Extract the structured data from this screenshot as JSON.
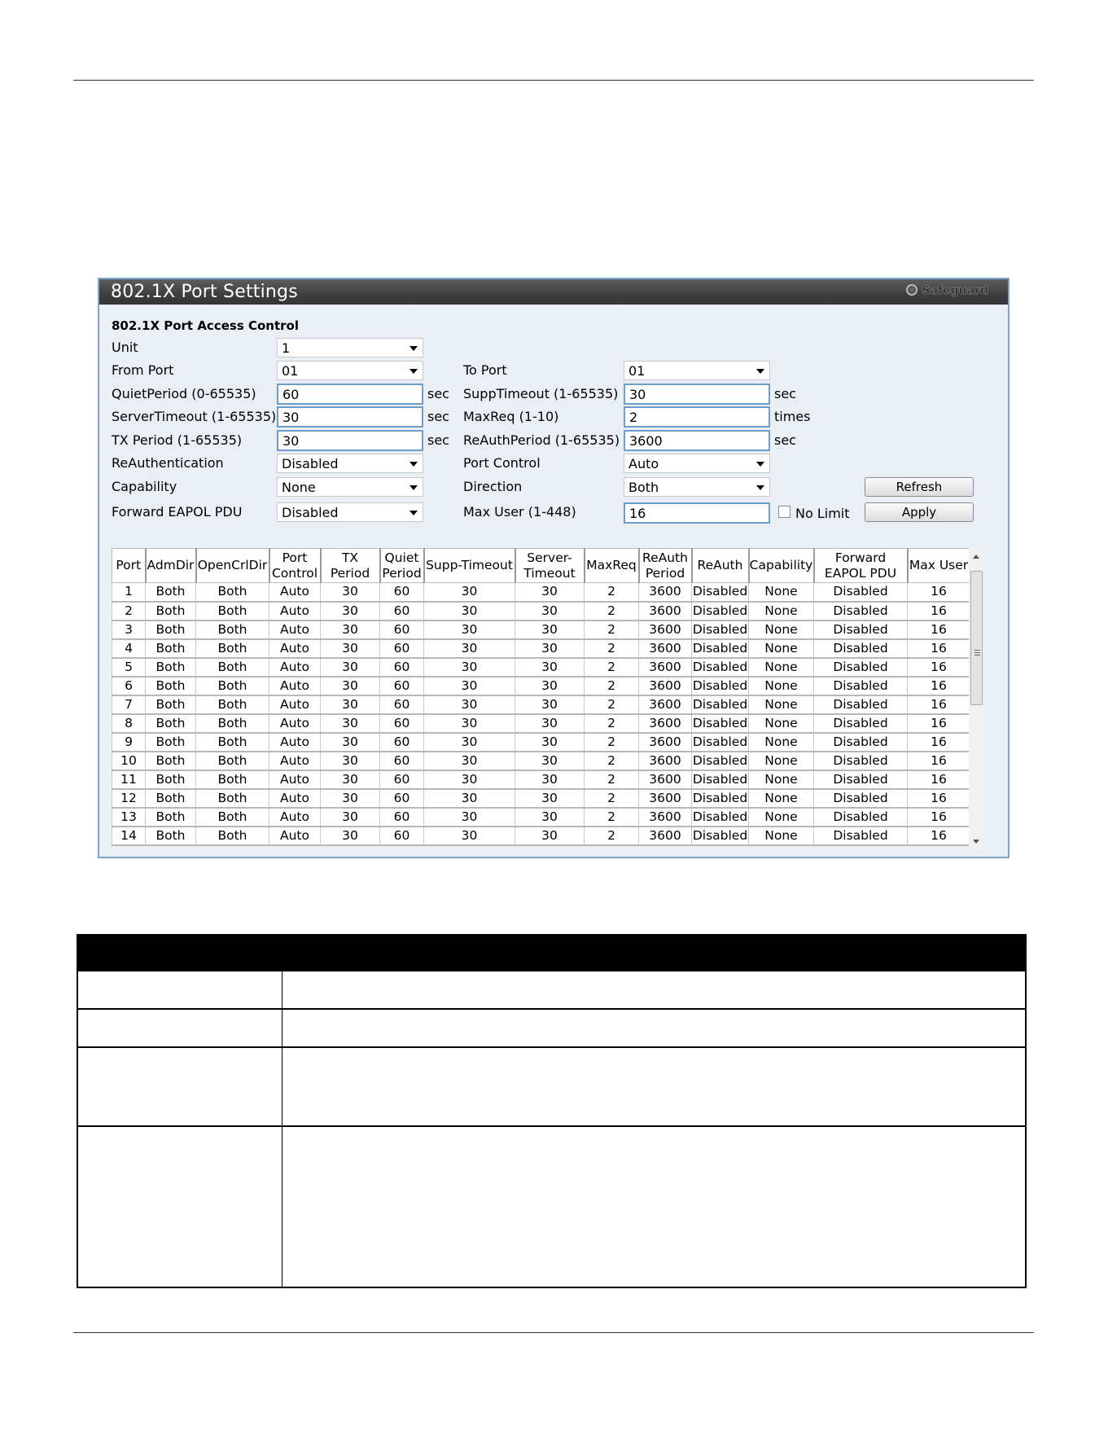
{
  "panel": {
    "title": "802.1X Port Settings",
    "safeguard": "Safeguard",
    "section": "802.1X Port Access Control"
  },
  "form": {
    "unit": {
      "label": "Unit",
      "value": "1"
    },
    "from_port": {
      "label": "From Port",
      "value": "01"
    },
    "to_port": {
      "label": "To Port",
      "value": "01"
    },
    "quiet_period": {
      "label": "QuietPeriod (0-65535)",
      "value": "60",
      "unit": "sec"
    },
    "supp_timeout": {
      "label": "SuppTimeout (1-65535)",
      "value": "30",
      "unit": "sec"
    },
    "server_timeout": {
      "label": "ServerTimeout (1-65535)",
      "value": "30",
      "unit": "sec"
    },
    "max_req": {
      "label": "MaxReq (1-10)",
      "value": "2",
      "unit": "times"
    },
    "tx_period": {
      "label": "TX Period (1-65535)",
      "value": "30",
      "unit": "sec"
    },
    "reauth_period": {
      "label": "ReAuthPeriod (1-65535)",
      "value": "3600",
      "unit": "sec"
    },
    "reauthentication": {
      "label": "ReAuthentication",
      "value": "Disabled"
    },
    "port_control": {
      "label": "Port Control",
      "value": "Auto"
    },
    "capability": {
      "label": "Capability",
      "value": "None"
    },
    "direction": {
      "label": "Direction",
      "value": "Both"
    },
    "forward_eapol": {
      "label": "Forward EAPOL PDU",
      "value": "Disabled"
    },
    "max_user": {
      "label": "Max User (1-448)",
      "value": "16"
    },
    "no_limit": {
      "label": "No Limit"
    }
  },
  "buttons": {
    "refresh": "Refresh",
    "apply": "Apply"
  },
  "table": {
    "headers": [
      "Port",
      "AdmDir",
      "OpenCrlDir",
      "Port\nControl",
      "TX\nPeriod",
      "Quiet\nPeriod",
      "Supp-Timeout",
      "Server-\nTimeout",
      "MaxReq",
      "ReAuth\nPeriod",
      "ReAuth",
      "Capability",
      "Forward\nEAPOL PDU",
      "Max User"
    ],
    "rows": [
      [
        "1",
        "Both",
        "Both",
        "Auto",
        "30",
        "60",
        "30",
        "30",
        "2",
        "3600",
        "Disabled",
        "None",
        "Disabled",
        "16"
      ],
      [
        "2",
        "Both",
        "Both",
        "Auto",
        "30",
        "60",
        "30",
        "30",
        "2",
        "3600",
        "Disabled",
        "None",
        "Disabled",
        "16"
      ],
      [
        "3",
        "Both",
        "Both",
        "Auto",
        "30",
        "60",
        "30",
        "30",
        "2",
        "3600",
        "Disabled",
        "None",
        "Disabled",
        "16"
      ],
      [
        "4",
        "Both",
        "Both",
        "Auto",
        "30",
        "60",
        "30",
        "30",
        "2",
        "3600",
        "Disabled",
        "None",
        "Disabled",
        "16"
      ],
      [
        "5",
        "Both",
        "Both",
        "Auto",
        "30",
        "60",
        "30",
        "30",
        "2",
        "3600",
        "Disabled",
        "None",
        "Disabled",
        "16"
      ],
      [
        "6",
        "Both",
        "Both",
        "Auto",
        "30",
        "60",
        "30",
        "30",
        "2",
        "3600",
        "Disabled",
        "None",
        "Disabled",
        "16"
      ],
      [
        "7",
        "Both",
        "Both",
        "Auto",
        "30",
        "60",
        "30",
        "30",
        "2",
        "3600",
        "Disabled",
        "None",
        "Disabled",
        "16"
      ],
      [
        "8",
        "Both",
        "Both",
        "Auto",
        "30",
        "60",
        "30",
        "30",
        "2",
        "3600",
        "Disabled",
        "None",
        "Disabled",
        "16"
      ],
      [
        "9",
        "Both",
        "Both",
        "Auto",
        "30",
        "60",
        "30",
        "30",
        "2",
        "3600",
        "Disabled",
        "None",
        "Disabled",
        "16"
      ],
      [
        "10",
        "Both",
        "Both",
        "Auto",
        "30",
        "60",
        "30",
        "30",
        "2",
        "3600",
        "Disabled",
        "None",
        "Disabled",
        "16"
      ],
      [
        "11",
        "Both",
        "Both",
        "Auto",
        "30",
        "60",
        "30",
        "30",
        "2",
        "3600",
        "Disabled",
        "None",
        "Disabled",
        "16"
      ],
      [
        "12",
        "Both",
        "Both",
        "Auto",
        "30",
        "60",
        "30",
        "30",
        "2",
        "3600",
        "Disabled",
        "None",
        "Disabled",
        "16"
      ],
      [
        "13",
        "Both",
        "Both",
        "Auto",
        "30",
        "60",
        "30",
        "30",
        "2",
        "3600",
        "Disabled",
        "None",
        "Disabled",
        "16"
      ],
      [
        "14",
        "Both",
        "Both",
        "Auto",
        "30",
        "60",
        "30",
        "30",
        "2",
        "3600",
        "Disabled",
        "None",
        "Disabled",
        "16"
      ]
    ]
  }
}
